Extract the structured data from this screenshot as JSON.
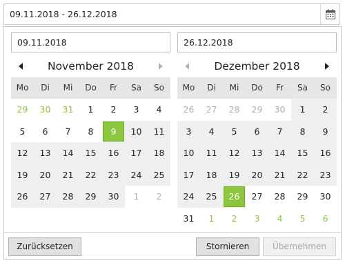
{
  "range": {
    "value": "09.11.2018 - 26.12.2018",
    "icon": "calendar-icon"
  },
  "left": {
    "input": "09.11.2018",
    "month_title": "November 2018",
    "weekdays": [
      "Mo",
      "Di",
      "Mi",
      "Do",
      "Fr",
      "Sa",
      "So"
    ],
    "days": [
      {
        "d": "29",
        "t": "other"
      },
      {
        "d": "30",
        "t": "other"
      },
      {
        "d": "31",
        "t": "other"
      },
      {
        "d": "1",
        "t": ""
      },
      {
        "d": "2",
        "t": ""
      },
      {
        "d": "3",
        "t": ""
      },
      {
        "d": "4",
        "t": ""
      },
      {
        "d": "5",
        "t": ""
      },
      {
        "d": "6",
        "t": ""
      },
      {
        "d": "7",
        "t": ""
      },
      {
        "d": "8",
        "t": ""
      },
      {
        "d": "9",
        "t": "selected"
      },
      {
        "d": "10",
        "t": "inrange"
      },
      {
        "d": "11",
        "t": "inrange"
      },
      {
        "d": "12",
        "t": "inrange"
      },
      {
        "d": "13",
        "t": "inrange"
      },
      {
        "d": "14",
        "t": "inrange"
      },
      {
        "d": "15",
        "t": "inrange"
      },
      {
        "d": "16",
        "t": "inrange"
      },
      {
        "d": "17",
        "t": "inrange"
      },
      {
        "d": "18",
        "t": "inrange"
      },
      {
        "d": "19",
        "t": "inrange"
      },
      {
        "d": "20",
        "t": "inrange"
      },
      {
        "d": "21",
        "t": "inrange"
      },
      {
        "d": "22",
        "t": "inrange"
      },
      {
        "d": "23",
        "t": "inrange"
      },
      {
        "d": "24",
        "t": "inrange"
      },
      {
        "d": "25",
        "t": "inrange"
      },
      {
        "d": "26",
        "t": "inrange"
      },
      {
        "d": "27",
        "t": "inrange"
      },
      {
        "d": "28",
        "t": "inrange"
      },
      {
        "d": "29",
        "t": "inrange"
      },
      {
        "d": "30",
        "t": "inrange"
      },
      {
        "d": "1",
        "t": "other-after"
      },
      {
        "d": "2",
        "t": "other-after"
      }
    ]
  },
  "right": {
    "input": "26.12.2018",
    "month_title": "Dezember 2018",
    "weekdays": [
      "Mo",
      "Di",
      "Mi",
      "Do",
      "Fr",
      "Sa",
      "So"
    ],
    "days": [
      {
        "d": "26",
        "t": "other-before"
      },
      {
        "d": "27",
        "t": "other-before"
      },
      {
        "d": "28",
        "t": "other-before"
      },
      {
        "d": "29",
        "t": "other-before"
      },
      {
        "d": "30",
        "t": "other-before"
      },
      {
        "d": "1",
        "t": "inrange"
      },
      {
        "d": "2",
        "t": "inrange"
      },
      {
        "d": "3",
        "t": "inrange"
      },
      {
        "d": "4",
        "t": "inrange"
      },
      {
        "d": "5",
        "t": "inrange"
      },
      {
        "d": "6",
        "t": "inrange"
      },
      {
        "d": "7",
        "t": "inrange"
      },
      {
        "d": "8",
        "t": "inrange"
      },
      {
        "d": "9",
        "t": "inrange"
      },
      {
        "d": "10",
        "t": "inrange"
      },
      {
        "d": "11",
        "t": "inrange"
      },
      {
        "d": "12",
        "t": "inrange"
      },
      {
        "d": "13",
        "t": "inrange"
      },
      {
        "d": "14",
        "t": "inrange"
      },
      {
        "d": "15",
        "t": "inrange"
      },
      {
        "d": "16",
        "t": "inrange"
      },
      {
        "d": "17",
        "t": "inrange"
      },
      {
        "d": "18",
        "t": "inrange"
      },
      {
        "d": "19",
        "t": "inrange"
      },
      {
        "d": "20",
        "t": "inrange"
      },
      {
        "d": "21",
        "t": "inrange"
      },
      {
        "d": "22",
        "t": "inrange"
      },
      {
        "d": "23",
        "t": "inrange"
      },
      {
        "d": "24",
        "t": "inrange"
      },
      {
        "d": "25",
        "t": "inrange"
      },
      {
        "d": "26",
        "t": "selected"
      },
      {
        "d": "27",
        "t": ""
      },
      {
        "d": "28",
        "t": ""
      },
      {
        "d": "29",
        "t": ""
      },
      {
        "d": "30",
        "t": ""
      },
      {
        "d": "31",
        "t": ""
      },
      {
        "d": "1",
        "t": "other"
      },
      {
        "d": "2",
        "t": "other"
      },
      {
        "d": "3",
        "t": "other"
      },
      {
        "d": "4",
        "t": "other"
      },
      {
        "d": "5",
        "t": "other"
      },
      {
        "d": "6",
        "t": "other"
      }
    ]
  },
  "buttons": {
    "reset": "Zurücksetzen",
    "cancel": "Stornieren",
    "apply": "Übernehmen"
  },
  "colors": {
    "accent": "#8cc63f",
    "range_bg": "#efefef",
    "header_bg": "#e6e6e6"
  }
}
